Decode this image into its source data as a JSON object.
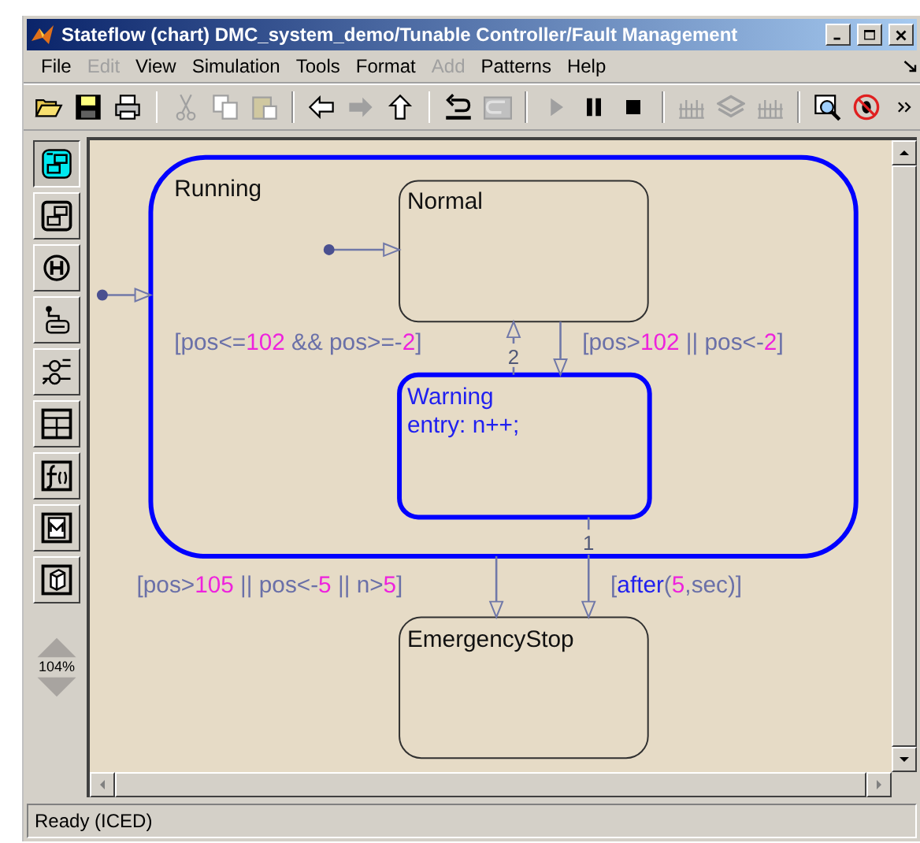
{
  "window": {
    "title": "Stateflow (chart) DMC_system_demo/Tunable Controller/Fault Management"
  },
  "menu": [
    {
      "label": "File",
      "disabled": false
    },
    {
      "label": "Edit",
      "disabled": true
    },
    {
      "label": "View",
      "disabled": false
    },
    {
      "label": "Simulation",
      "disabled": false
    },
    {
      "label": "Tools",
      "disabled": false
    },
    {
      "label": "Format",
      "disabled": false
    },
    {
      "label": "Add",
      "disabled": true
    },
    {
      "label": "Patterns",
      "disabled": false
    },
    {
      "label": "Help",
      "disabled": false
    }
  ],
  "toolbar": [
    {
      "kind": "open",
      "disabled": false
    },
    {
      "kind": "save",
      "disabled": false
    },
    {
      "kind": "print",
      "disabled": false
    },
    {
      "kind": "separator"
    },
    {
      "kind": "cut",
      "disabled": true
    },
    {
      "kind": "copy",
      "disabled": true
    },
    {
      "kind": "paste",
      "disabled": true
    },
    {
      "kind": "separator"
    },
    {
      "kind": "back",
      "disabled": false
    },
    {
      "kind": "forward",
      "disabled": true
    },
    {
      "kind": "up",
      "disabled": false
    },
    {
      "kind": "separator"
    },
    {
      "kind": "undo",
      "disabled": false
    },
    {
      "kind": "redo",
      "disabled": true
    },
    {
      "kind": "separator"
    },
    {
      "kind": "play",
      "disabled": true
    },
    {
      "kind": "pause",
      "disabled": false
    },
    {
      "kind": "stop",
      "disabled": false
    },
    {
      "kind": "separator"
    },
    {
      "kind": "build",
      "disabled": true
    },
    {
      "kind": "layers",
      "disabled": true
    },
    {
      "kind": "build",
      "disabled": true
    },
    {
      "kind": "separator"
    },
    {
      "kind": "explorer",
      "disabled": false
    },
    {
      "kind": "debug",
      "disabled": false
    }
  ],
  "palette": [
    {
      "kind": "state",
      "selected": true
    },
    {
      "kind": "box",
      "selected": false
    },
    {
      "kind": "history",
      "selected": false
    },
    {
      "kind": "default",
      "selected": false
    },
    {
      "kind": "junction",
      "selected": false
    },
    {
      "kind": "table",
      "selected": false
    },
    {
      "kind": "function",
      "selected": false
    },
    {
      "kind": "matlab",
      "selected": false
    },
    {
      "kind": "simulink",
      "selected": false
    }
  ],
  "zoom": {
    "reading": "104%"
  },
  "chart": {
    "states": [
      {
        "name": "Running",
        "highlighted": true,
        "selected": false
      },
      {
        "name": "Normal",
        "highlighted": false,
        "selected": false
      },
      {
        "name": "Warning",
        "actions": "entry: n++;",
        "highlighted": true,
        "selected": true
      },
      {
        "name": "EmergencyStop",
        "highlighted": false,
        "selected": false
      }
    ],
    "transitions": [
      {
        "kind": "default"
      },
      {
        "kind": "default"
      },
      {
        "kind": "transition",
        "order": "2",
        "label": [
          {
            "kind": "plain",
            "text": "[pos<="
          },
          {
            "kind": "number",
            "text": "102"
          },
          {
            "kind": "plain",
            "text": " && pos>=-"
          },
          {
            "kind": "number",
            "text": "2"
          },
          {
            "kind": "plain",
            "text": "]"
          }
        ]
      },
      {
        "kind": "transition",
        "label": [
          {
            "kind": "plain",
            "text": "[pos>"
          },
          {
            "kind": "number",
            "text": "102"
          },
          {
            "kind": "plain",
            "text": " || pos<-"
          },
          {
            "kind": "number",
            "text": "2"
          },
          {
            "kind": "plain",
            "text": "]"
          }
        ]
      },
      {
        "kind": "transition",
        "label": [
          {
            "kind": "plain",
            "text": "[pos>"
          },
          {
            "kind": "number",
            "text": "105"
          },
          {
            "kind": "plain",
            "text": " || pos<-"
          },
          {
            "kind": "number",
            "text": "5"
          },
          {
            "kind": "plain",
            "text": " || n>"
          },
          {
            "kind": "number",
            "text": "5"
          },
          {
            "kind": "plain",
            "text": "]"
          }
        ]
      },
      {
        "kind": "transition",
        "order": "1",
        "label": [
          {
            "kind": "plain",
            "text": "["
          },
          {
            "kind": "keyword",
            "text": "after"
          },
          {
            "kind": "plain",
            "text": "("
          },
          {
            "kind": "number",
            "text": "5"
          },
          {
            "kind": "plain",
            "text": ",sec)]"
          }
        ]
      }
    ]
  },
  "status_bar": {
    "text": "Ready (ICED)"
  }
}
